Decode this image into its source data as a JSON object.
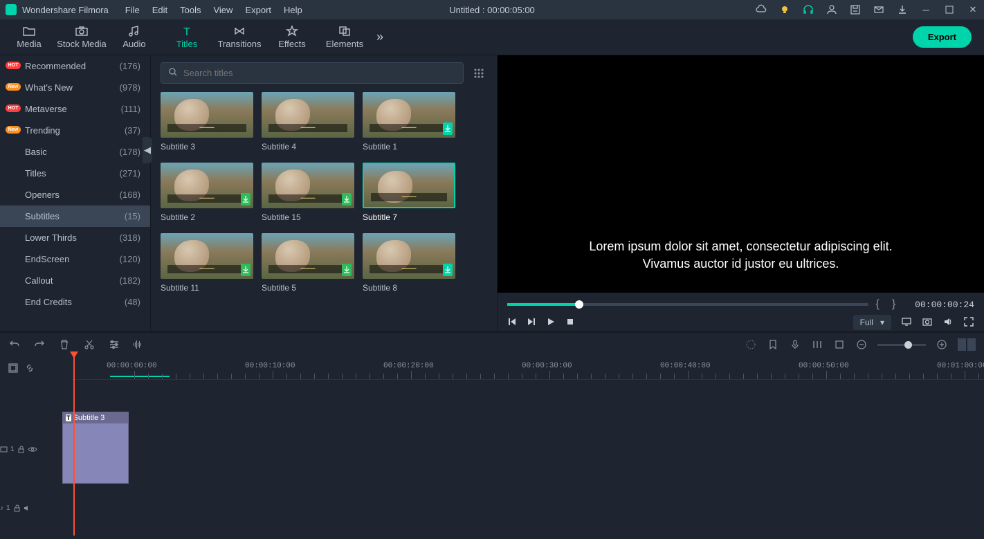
{
  "app": {
    "name": "Wondershare Filmora"
  },
  "menus": [
    "File",
    "Edit",
    "Tools",
    "View",
    "Export",
    "Help"
  ],
  "document_title": "Untitled : 00:00:05:00",
  "toolbar_tabs": [
    {
      "label": "Media",
      "icon": "folder"
    },
    {
      "label": "Stock Media",
      "icon": "camera"
    },
    {
      "label": "Audio",
      "icon": "music"
    },
    {
      "label": "Titles",
      "icon": "text",
      "active": true
    },
    {
      "label": "Transitions",
      "icon": "transition"
    },
    {
      "label": "Effects",
      "icon": "star"
    },
    {
      "label": "Elements",
      "icon": "layers"
    }
  ],
  "export_button": "Export",
  "sidebar": {
    "items": [
      {
        "label": "Recommended",
        "count": "(176)",
        "badge": "hot"
      },
      {
        "label": "What's New",
        "count": "(978)",
        "badge": "new"
      },
      {
        "label": "Metaverse",
        "count": "(111)",
        "badge": "hot"
      },
      {
        "label": "Trending",
        "count": "(37)",
        "badge": "new"
      },
      {
        "label": "Basic",
        "count": "(178)"
      },
      {
        "label": "Titles",
        "count": "(271)"
      },
      {
        "label": "Openers",
        "count": "(168)"
      },
      {
        "label": "Subtitles",
        "count": "(15)",
        "selected": true
      },
      {
        "label": "Lower Thirds",
        "count": "(318)"
      },
      {
        "label": "EndScreen",
        "count": "(120)"
      },
      {
        "label": "Callout",
        "count": "(182)"
      },
      {
        "label": "End Credits",
        "count": "(48)"
      }
    ]
  },
  "search": {
    "placeholder": "Search titles"
  },
  "thumbs": [
    {
      "label": "Subtitle 3"
    },
    {
      "label": "Subtitle 4"
    },
    {
      "label": "Subtitle 1",
      "dl": true,
      "teal_dl": true
    },
    {
      "label": "Subtitle 2",
      "dl": true
    },
    {
      "label": "Subtitle 15",
      "dl": true
    },
    {
      "label": "Subtitle 7",
      "selected": true
    },
    {
      "label": "Subtitle 11",
      "dl": true
    },
    {
      "label": "Subtitle 5",
      "dl": true
    },
    {
      "label": "Subtitle 8",
      "dl": true,
      "teal_dl": true
    }
  ],
  "preview": {
    "text_line1": "Lorem ipsum dolor sit amet, consectetur adipiscing elit.",
    "text_line2": "Vivamus auctor id justor eu ultrices.",
    "timecode": "00:00:00:24",
    "quality": "Full"
  },
  "ruler_marks": [
    "00:00:00:00",
    "00:00:10:00",
    "00:00:20:00",
    "00:00:30:00",
    "00:00:40:00",
    "00:00:50:00",
    "00:01:00:00"
  ],
  "clip": {
    "label": "Subtitle 3"
  },
  "track_labels": {
    "video": "1",
    "audio": "1"
  }
}
